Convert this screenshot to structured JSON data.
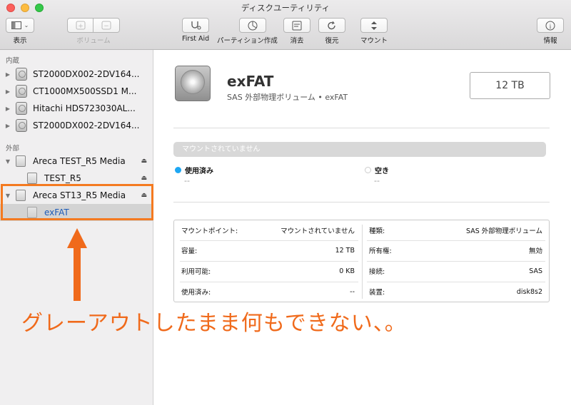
{
  "window": {
    "title": "ディスクユーティリティ",
    "traffic_lights": [
      "#fc605c",
      "#fdbc40",
      "#34c84a"
    ]
  },
  "toolbar": {
    "view_label": "表示",
    "volume_label": "ボリューム",
    "first_aid_label": "First Aid",
    "partition_label": "パーティション作成",
    "erase_label": "消去",
    "restore_label": "復元",
    "mount_label": "マウント",
    "info_label": "情報"
  },
  "sidebar": {
    "internal_header": "内蔵",
    "internal": [
      {
        "label": "ST2000DX002-2DV164..."
      },
      {
        "label": "CT1000MX500SSD1 M..."
      },
      {
        "label": "Hitachi HDS723030AL..."
      },
      {
        "label": "ST2000DX002-2DV164..."
      }
    ],
    "external_header": "外部",
    "external": [
      {
        "label": "Areca TEST_R5 Media",
        "child": "TEST_R5"
      },
      {
        "label": "Areca ST13_R5 Media",
        "child": "exFAT"
      }
    ],
    "selected_color": "#1c5bb8",
    "highlight_color": "#f47a20"
  },
  "volume": {
    "name": "exFAT",
    "subtitle": "SAS 外部物理ボリューム • exFAT",
    "capacity": "12 TB"
  },
  "usage": {
    "bar_text": "マウントされていません",
    "used_label": "使用済み",
    "used_value": "--",
    "used_color": "#1ea7f3",
    "free_label": "空き",
    "free_value": "--"
  },
  "info": {
    "left": [
      {
        "key": "マウントポイント:",
        "value": "マウントされていません"
      },
      {
        "key": "容量:",
        "value": "12 TB"
      },
      {
        "key": "利用可能:",
        "value": "0 KB"
      },
      {
        "key": "使用済み:",
        "value": "--"
      }
    ],
    "right": [
      {
        "key": "種類:",
        "value": "SAS 外部物理ボリューム"
      },
      {
        "key": "所有権:",
        "value": "無効"
      },
      {
        "key": "接続:",
        "value": "SAS"
      },
      {
        "key": "装置:",
        "value": "disk8s2"
      }
    ]
  },
  "annotation": {
    "text": "グレーアウトしたまま何もできない、。",
    "color": "#f06a1b"
  }
}
